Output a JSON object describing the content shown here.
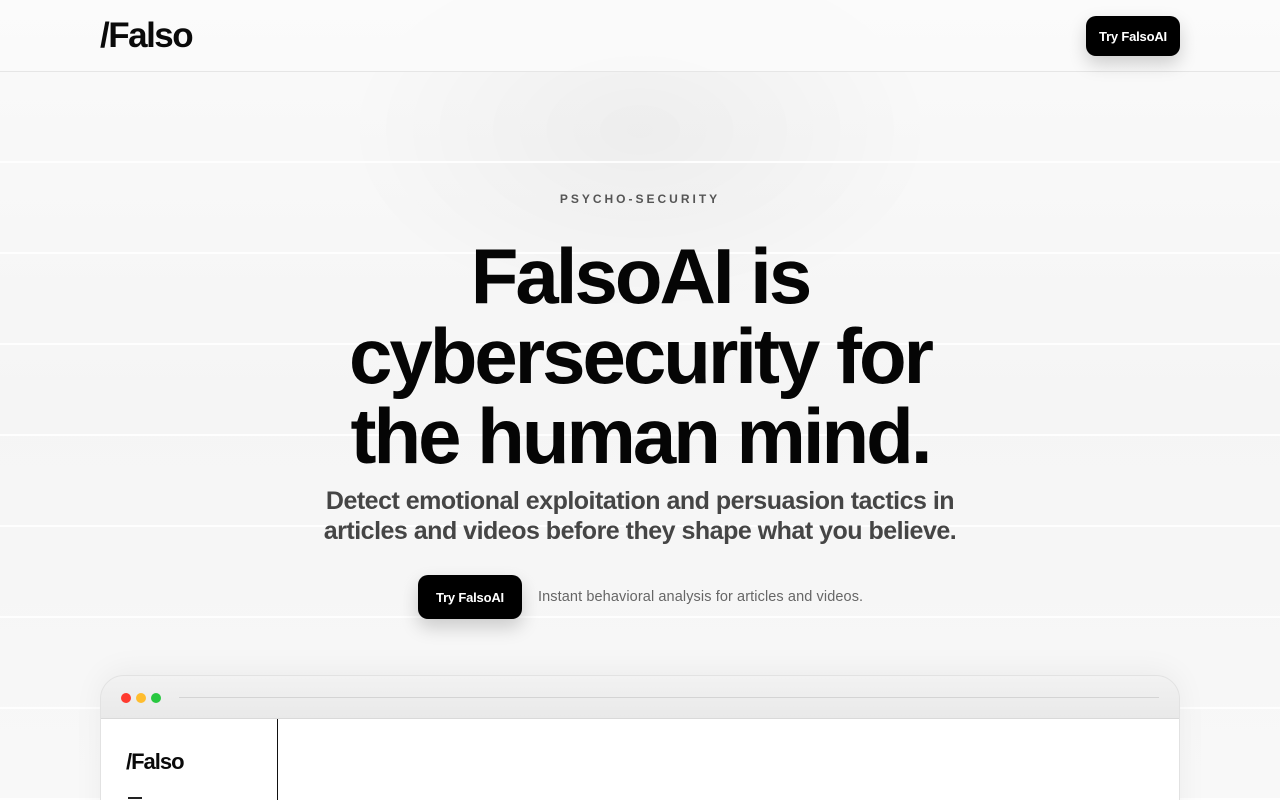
{
  "nav": {
    "logo": "/Falso",
    "cta_label": "Try FalsoAI"
  },
  "hero": {
    "eyebrow": "PSYCHO-SECURITY",
    "headline": "FalsoAI is cybersecurity for the human mind.",
    "subheadline": "Detect emotional exploitation and persuasion tactics in articles and videos before they shape what you believe.",
    "cta_label": "Try FalsoAI",
    "cta_note": "Instant behavioral analysis for articles and videos."
  },
  "preview": {
    "window_dots": [
      "#ff3b30",
      "#ffbd2e",
      "#28c840"
    ],
    "app_logo": "/Falso",
    "menu_icon": "menu-icon"
  },
  "colors": {
    "primary": "#000000",
    "background": "#f7f7f7",
    "text": "#0a0a0a",
    "muted": "#666666"
  }
}
